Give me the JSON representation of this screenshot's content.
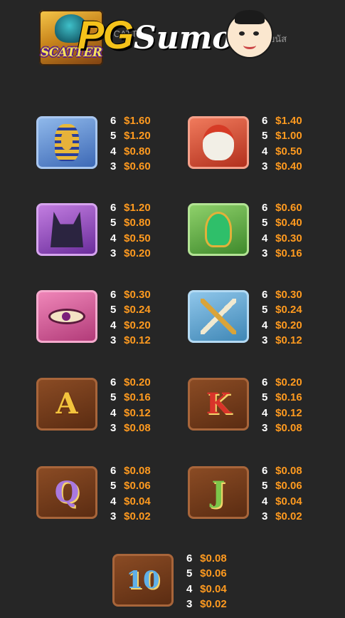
{
  "header": {
    "scatter_label": "SCATTER",
    "scatter_subtext": "SCATT",
    "scatter_thai": "โบนัส",
    "logo_pg": "PG",
    "logo_sumo": "Sumo"
  },
  "colors": {
    "count": "#ffffff",
    "payout": "#ff9a1f",
    "background": "#262626"
  },
  "symbols": [
    {
      "icon": "pharaoh-mask-icon",
      "pays": [
        {
          "count": "6",
          "value": "$1.60"
        },
        {
          "count": "5",
          "value": "$1.20"
        },
        {
          "count": "4",
          "value": "$0.80"
        },
        {
          "count": "3",
          "value": "$0.60"
        }
      ]
    },
    {
      "icon": "horus-bird-icon",
      "pays": [
        {
          "count": "6",
          "value": "$1.40"
        },
        {
          "count": "5",
          "value": "$1.00"
        },
        {
          "count": "4",
          "value": "$0.50"
        },
        {
          "count": "3",
          "value": "$0.40"
        }
      ]
    },
    {
      "icon": "anubis-icon",
      "pays": [
        {
          "count": "6",
          "value": "$1.20"
        },
        {
          "count": "5",
          "value": "$0.80"
        },
        {
          "count": "4",
          "value": "$0.50"
        },
        {
          "count": "3",
          "value": "$0.20"
        }
      ]
    },
    {
      "icon": "cobra-icon",
      "pays": [
        {
          "count": "6",
          "value": "$0.60"
        },
        {
          "count": "5",
          "value": "$0.40"
        },
        {
          "count": "4",
          "value": "$0.30"
        },
        {
          "count": "3",
          "value": "$0.16"
        }
      ]
    },
    {
      "icon": "eye-of-horus-icon",
      "pays": [
        {
          "count": "6",
          "value": "$0.30"
        },
        {
          "count": "5",
          "value": "$0.24"
        },
        {
          "count": "4",
          "value": "$0.20"
        },
        {
          "count": "3",
          "value": "$0.12"
        }
      ]
    },
    {
      "icon": "crook-and-flail-icon",
      "pays": [
        {
          "count": "6",
          "value": "$0.30"
        },
        {
          "count": "5",
          "value": "$0.24"
        },
        {
          "count": "4",
          "value": "$0.20"
        },
        {
          "count": "3",
          "value": "$0.12"
        }
      ]
    },
    {
      "icon": "letter-a-icon",
      "label": "A",
      "pays": [
        {
          "count": "6",
          "value": "$0.20"
        },
        {
          "count": "5",
          "value": "$0.16"
        },
        {
          "count": "4",
          "value": "$0.12"
        },
        {
          "count": "3",
          "value": "$0.08"
        }
      ]
    },
    {
      "icon": "letter-k-icon",
      "label": "K",
      "pays": [
        {
          "count": "6",
          "value": "$0.20"
        },
        {
          "count": "5",
          "value": "$0.16"
        },
        {
          "count": "4",
          "value": "$0.12"
        },
        {
          "count": "3",
          "value": "$0.08"
        }
      ]
    },
    {
      "icon": "letter-q-icon",
      "label": "Q",
      "pays": [
        {
          "count": "6",
          "value": "$0.08"
        },
        {
          "count": "5",
          "value": "$0.06"
        },
        {
          "count": "4",
          "value": "$0.04"
        },
        {
          "count": "3",
          "value": "$0.02"
        }
      ]
    },
    {
      "icon": "letter-j-icon",
      "label": "J",
      "pays": [
        {
          "count": "6",
          "value": "$0.08"
        },
        {
          "count": "5",
          "value": "$0.06"
        },
        {
          "count": "4",
          "value": "$0.04"
        },
        {
          "count": "3",
          "value": "$0.02"
        }
      ]
    },
    {
      "icon": "number-10-icon",
      "label": "10",
      "pays": [
        {
          "count": "6",
          "value": "$0.08"
        },
        {
          "count": "5",
          "value": "$0.06"
        },
        {
          "count": "4",
          "value": "$0.04"
        },
        {
          "count": "3",
          "value": "$0.02"
        }
      ]
    }
  ]
}
